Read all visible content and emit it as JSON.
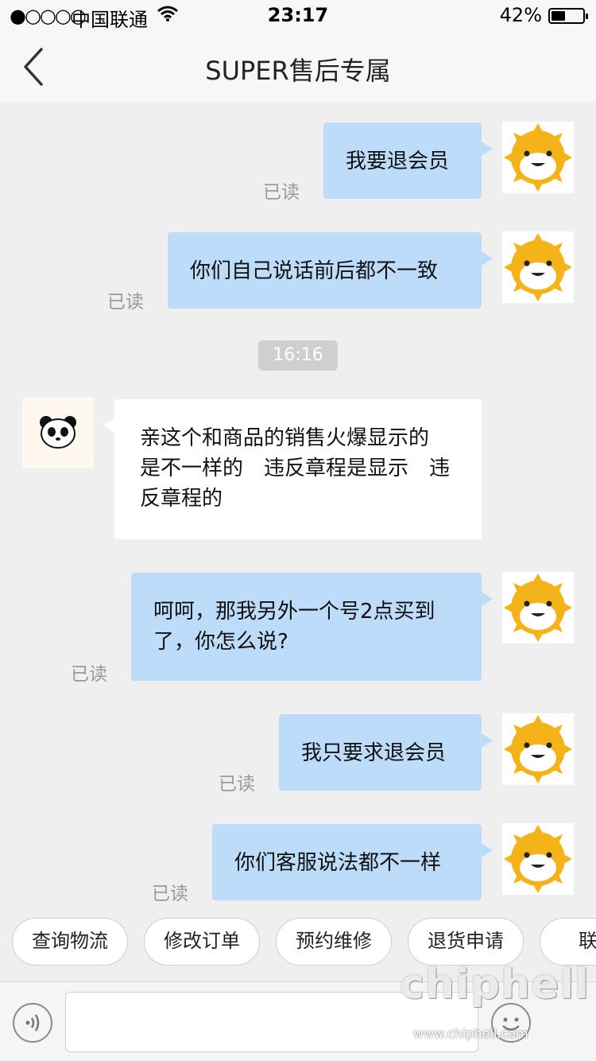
{
  "status_bar": {
    "signal": "●○○○○",
    "carrier": "中国联通",
    "time": "23:17",
    "battery_percent": "42%",
    "battery_level": 0.42
  },
  "header": {
    "title": "SUPER售后专属"
  },
  "messages": [
    {
      "sender": "me",
      "text": "我要退会员",
      "status": "已读"
    },
    {
      "sender": "me",
      "text": "你们自己说话前后都不一致",
      "status": "已读"
    },
    {
      "type": "time",
      "text": "16:16"
    },
    {
      "sender": "agent",
      "lines": [
        "亲这个和商品的销售火爆显示的",
        "是不一样的　违反章程是显示　违",
        "反章程的"
      ]
    },
    {
      "sender": "me",
      "lines": [
        "呵呵，那我另外一个号2点买到",
        "了，你怎么说?"
      ],
      "status": "已读"
    },
    {
      "sender": "me",
      "text": "我只要求退会员",
      "status": "已读"
    },
    {
      "sender": "me",
      "text": "你们客服说法都不一样",
      "status": "已读"
    }
  ],
  "quick_actions": [
    "查询物流",
    "修改订单",
    "预约维修",
    "退货申请",
    "联系"
  ],
  "watermark": {
    "logo": "chiphell",
    "url": "www.chiphell.com"
  },
  "colors": {
    "my_bubble": "#bcdcfa",
    "agent_bubble": "#ffffff",
    "background": "#efefef",
    "avatar_sun": "#f5b31a"
  }
}
